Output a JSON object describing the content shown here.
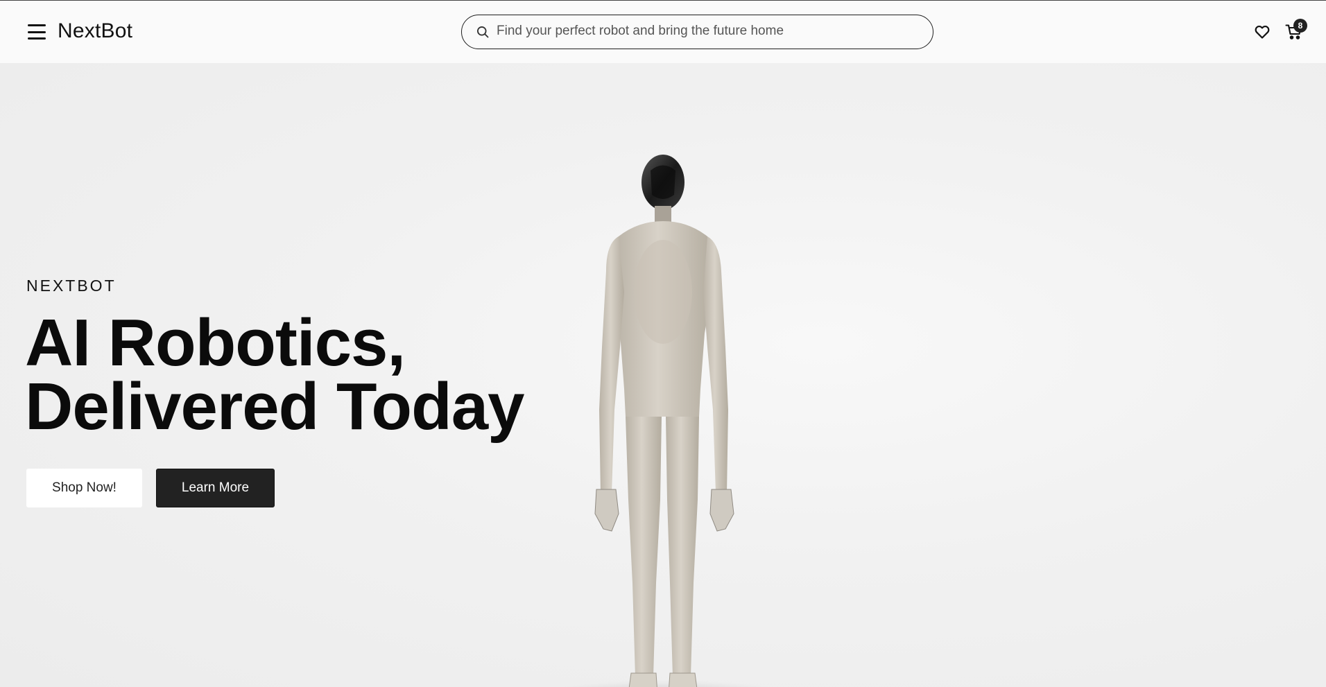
{
  "header": {
    "brand": "NextBot",
    "search_placeholder": "Find your perfect robot and bring the future home",
    "cart_count": "8"
  },
  "hero": {
    "eyebrow": "NEXTBOT",
    "headline_line1": "AI Robotics,",
    "headline_line2": "Delivered Today",
    "shop_button": "Shop Now!",
    "learn_button": "Learn More"
  },
  "icons": {
    "menu": "hamburger-menu-icon",
    "search": "search-icon",
    "wishlist": "heart-icon",
    "cart": "cart-icon"
  },
  "colors": {
    "background": "#f3f3f3",
    "primary_dark": "#222222",
    "text": "#111111"
  }
}
